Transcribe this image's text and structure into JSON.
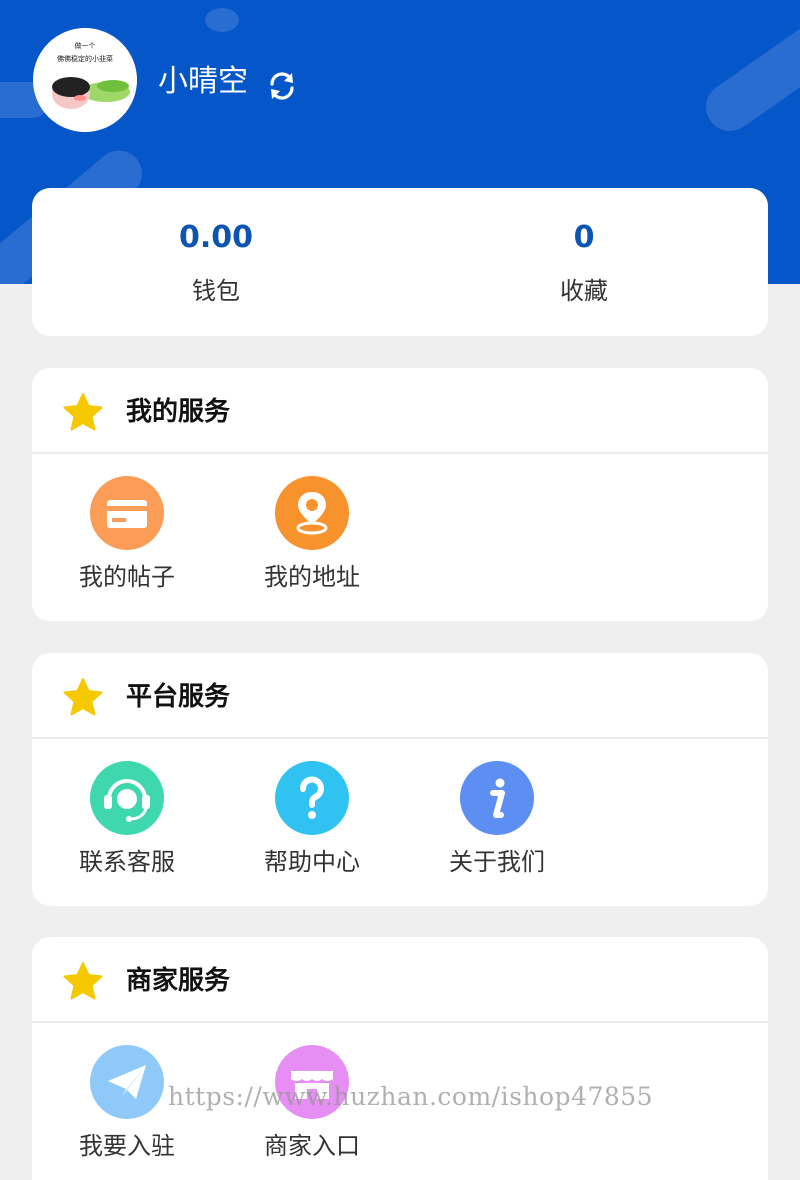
{
  "profile": {
    "username": "小晴空",
    "avatar_text_line1": "做一个",
    "avatar_text_line2": "佛佛稳定的小韭菜"
  },
  "stats": [
    {
      "value": "0.00",
      "label": "钱包"
    },
    {
      "value": "0",
      "label": "收藏"
    }
  ],
  "sections": [
    {
      "title": "我的服务",
      "items": [
        {
          "label": "我的帖子",
          "icon": "card-icon",
          "color": "#fb9d57"
        },
        {
          "label": "我的地址",
          "icon": "location-pin-icon",
          "color": "#f8922c"
        }
      ]
    },
    {
      "title": "平台服务",
      "items": [
        {
          "label": "联系客服",
          "icon": "headset-icon",
          "color": "#3fd8ae"
        },
        {
          "label": "帮助中心",
          "icon": "question-icon",
          "color": "#30c2f1"
        },
        {
          "label": "关于我们",
          "icon": "info-icon",
          "color": "#5d8ff2"
        }
      ]
    },
    {
      "title": "商家服务",
      "items": [
        {
          "label": "我要入驻",
          "icon": "paper-plane-icon",
          "color": "#8ec9fa"
        },
        {
          "label": "商家入口",
          "icon": "storefront-icon",
          "color": "#e68ef4"
        }
      ]
    }
  ],
  "watermark": "https://www.huzhan.com/ishop47855",
  "colors": {
    "header_bg": "#0556c8",
    "stat_value": "#0d55b3",
    "star": "#f6c800",
    "page_bg": "#efefef"
  }
}
